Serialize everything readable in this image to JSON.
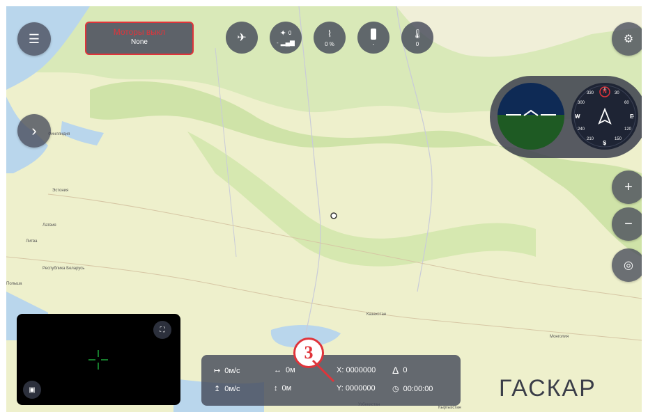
{
  "motor_status": {
    "title": "Моторы выкл",
    "value": "None"
  },
  "status_bar": [
    {
      "name": "airplane",
      "value": ""
    },
    {
      "name": "satellite",
      "value": "0",
      "sub": "-"
    },
    {
      "name": "wifi",
      "value": "0 %"
    },
    {
      "name": "battery",
      "value": "-"
    },
    {
      "name": "thermometer",
      "value": "0"
    }
  ],
  "compass": {
    "N": "N",
    "E": "E",
    "S": "S",
    "W": "W",
    "ticks": [
      "30",
      "60",
      "120",
      "150",
      "210",
      "240",
      "300",
      "330"
    ]
  },
  "telemetry": {
    "h_speed": "0м/с",
    "distance": "0м",
    "x": "X: 0000000",
    "heading": "0",
    "v_speed": "0м/с",
    "altitude": "0м",
    "y": "Y: 0000000",
    "time": "00:00:00"
  },
  "logo": "ГАСКАР",
  "annotation": "3",
  "map_labels": [
    "Финляндия",
    "Эстония",
    "Латвия",
    "Литва",
    "Республика Беларусь",
    "Польша",
    "Казахстан",
    "Узбекистан",
    "Кыргызстан",
    "Монголия"
  ]
}
